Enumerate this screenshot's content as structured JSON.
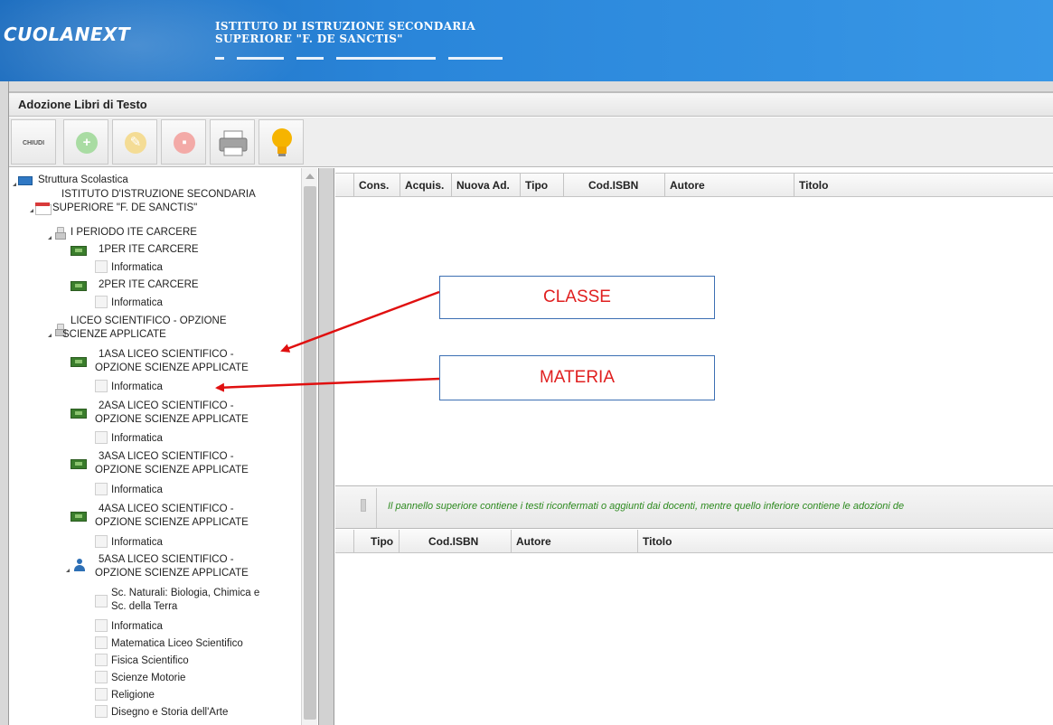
{
  "header": {
    "logo": "CUOLANEXT",
    "school_line1": "ISTITUTO DI ISTRUZIONE SECONDARIA",
    "school_line2": "SUPERIORE \"F. DE SANCTIS\""
  },
  "window": {
    "title": "Adozione Libri di Testo"
  },
  "toolbar": {
    "close_label": "CHIUDI",
    "buttons": [
      {
        "icon": "add-icon",
        "color": "#9fd79b"
      },
      {
        "icon": "edit-icon",
        "color": "#f3d98a"
      },
      {
        "icon": "delete-icon",
        "color": "#f2a3a0"
      },
      {
        "icon": "printer-icon",
        "color": "#9a9a9a"
      },
      {
        "icon": "lightbulb-icon",
        "color": "#f5b400"
      }
    ]
  },
  "tree": {
    "root": "Struttura Scolastica",
    "institute_line1": "ISTITUTO D'ISTRUZIONE SECONDARIA",
    "institute_line2": "SUPERIORE \"F. DE SANCTIS\"",
    "period1": "I PERIODO ITE CARCERE",
    "class_1per": "1PER ITE CARCERE",
    "subj_1per": "Informatica",
    "class_2per": "2PER ITE CARCERE",
    "subj_2per": "Informatica",
    "period2_line1": "LICEO SCIENTIFICO - OPZIONE",
    "period2_line2": "SCIENZE APPLICATE",
    "class_1asa_line1": "1ASA LICEO SCIENTIFICO -",
    "class_1asa_line2": "OPZIONE SCIENZE APPLICATE",
    "subj_1asa": "Informatica",
    "class_2asa_line1": "2ASA LICEO SCIENTIFICO -",
    "class_2asa_line2": "OPZIONE SCIENZE APPLICATE",
    "subj_2asa": "Informatica",
    "class_3asa_line1": "3ASA LICEO SCIENTIFICO -",
    "class_3asa_line2": "OPZIONE SCIENZE APPLICATE",
    "subj_3asa": "Informatica",
    "class_4asa_line1": "4ASA LICEO SCIENTIFICO -",
    "class_4asa_line2": "OPZIONE SCIENZE APPLICATE",
    "subj_4asa": "Informatica",
    "class_5asa_line1": "5ASA LICEO SCIENTIFICO -",
    "class_5asa_line2": "OPZIONE SCIENZE APPLICATE",
    "subj_5asa_1_line1": "Sc. Naturali: Biologia, Chimica e",
    "subj_5asa_1_line2": "Sc. della Terra",
    "subj_5asa_2": "Informatica",
    "subj_5asa_3": "Matematica Liceo Scientifico",
    "subj_5asa_4": "Fisica Scientifico",
    "subj_5asa_5": "Scienze Motorie",
    "subj_5asa_6": "Religione",
    "subj_5asa_7": "Disegno e Storia dell'Arte"
  },
  "grid_top": {
    "columns": [
      "Cons.",
      "Acquis.",
      "Nuova Ad.",
      "Tipo",
      "Cod.ISBN",
      "Autore",
      "Titolo"
    ]
  },
  "notice": "Il pannello superiore contiene i testi riconfermati o aggiunti dai docenti, mentre quello inferiore contiene le adozioni de",
  "grid_bottom": {
    "columns": [
      "Tipo",
      "Cod.ISBN",
      "Autore",
      "Titolo"
    ]
  },
  "annotations": {
    "classe": "CLASSE",
    "materia": "MATERIA",
    "arrow_color": "#e01010"
  }
}
